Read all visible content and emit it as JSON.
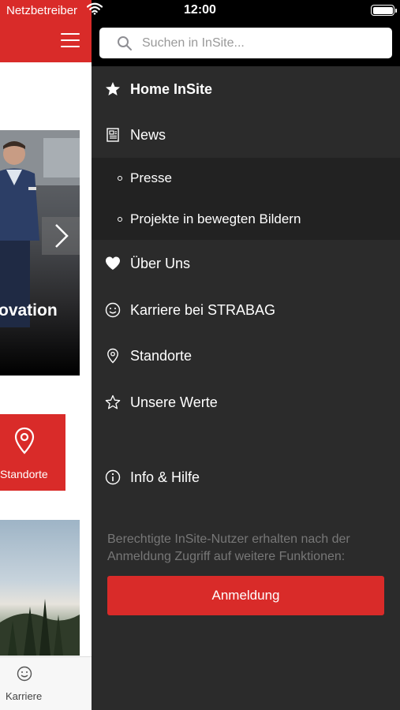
{
  "status_bar": {
    "carrier": "Netzbetreiber",
    "time": "12:00",
    "battery_level": 1.0
  },
  "background_app": {
    "hero_caption": "ovation",
    "tile_label": "Standorte",
    "tab_label": "Karriere",
    "colors": {
      "brand_red": "#d92b29"
    }
  },
  "drawer": {
    "search": {
      "placeholder": "Suchen in InSite..."
    },
    "menu": {
      "home": {
        "label": "Home InSite",
        "icon": "star-filled-icon"
      },
      "news": {
        "label": "News",
        "icon": "news-icon"
      },
      "presse": {
        "label": "Presse"
      },
      "projekte": {
        "label": "Projekte in bewegten Bildern"
      },
      "ueber_uns": {
        "label": "Über Uns",
        "icon": "heart-icon"
      },
      "karriere": {
        "label": "Karriere bei STRABAG",
        "icon": "smiley-icon"
      },
      "standorte": {
        "label": "Standorte",
        "icon": "location-pin-icon"
      },
      "werte": {
        "label": "Unsere Werte",
        "icon": "star-outline-icon"
      },
      "info": {
        "label": "Info & Hilfe",
        "icon": "info-icon"
      }
    },
    "login_hint": "Berechtigte InSite-Nutzer erhalten nach der Anmeldung Zugriff auf weitere Funktionen:",
    "login_button": "Anmeldung",
    "colors": {
      "background": "#2b2b2b",
      "submenu_background": "#222222",
      "button": "#d92b29"
    }
  }
}
